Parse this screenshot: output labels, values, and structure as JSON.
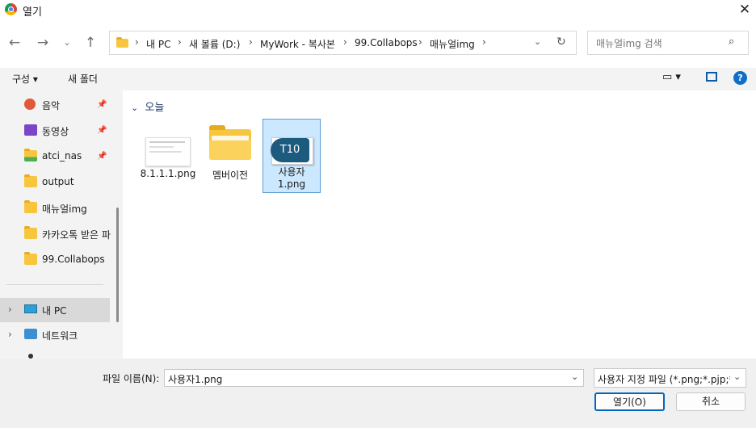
{
  "window": {
    "title": "열기"
  },
  "address": {
    "crumbs": [
      "내 PC",
      "새 볼륨 (D:)",
      "MyWork - 복사본",
      "99.Collabops",
      "매뉴얼img"
    ]
  },
  "search": {
    "placeholder": "매뉴얼img 검색"
  },
  "toolbar": {
    "organize_label": "구성 ▾",
    "new_folder_label": "새 폴더"
  },
  "sidebar": {
    "items": [
      {
        "label": "음악",
        "icon": "music-icon",
        "pinned": true
      },
      {
        "label": "동영상",
        "icon": "video-icon",
        "pinned": true
      },
      {
        "label": "atci_nas",
        "icon": "network-folder-icon",
        "pinned": true
      },
      {
        "label": "output",
        "icon": "folder-icon",
        "pinned": false
      },
      {
        "label": "매뉴얼img",
        "icon": "folder-icon",
        "pinned": false
      },
      {
        "label": "카카오톡 받은 파",
        "icon": "folder-icon",
        "pinned": false
      },
      {
        "label": "99.Collabops",
        "icon": "folder-icon",
        "pinned": false
      }
    ],
    "tree": [
      {
        "label": "내 PC",
        "icon": "pc-icon",
        "selected": true
      },
      {
        "label": "네트워크",
        "icon": "network-icon",
        "selected": false
      }
    ]
  },
  "content": {
    "group_header": "오늘",
    "files": [
      {
        "name": "8.1.1.1.png",
        "type": "image"
      },
      {
        "name": "멤버이전",
        "type": "folder"
      },
      {
        "name": "사용자\n1.png",
        "type": "image",
        "selected": true,
        "thumb_text": "T10"
      }
    ]
  },
  "bottom": {
    "filename_label": "파일 이름(N):",
    "filename_value": "사용자1.png",
    "filetype_value": "사용자 지정 파일 (*.png;*.pjp;*",
    "open_label": "열기(O)",
    "cancel_label": "취소"
  },
  "colors": {
    "accent": "#0067c0",
    "selection": "#cce8ff",
    "thumb": "#1c5a7e"
  }
}
